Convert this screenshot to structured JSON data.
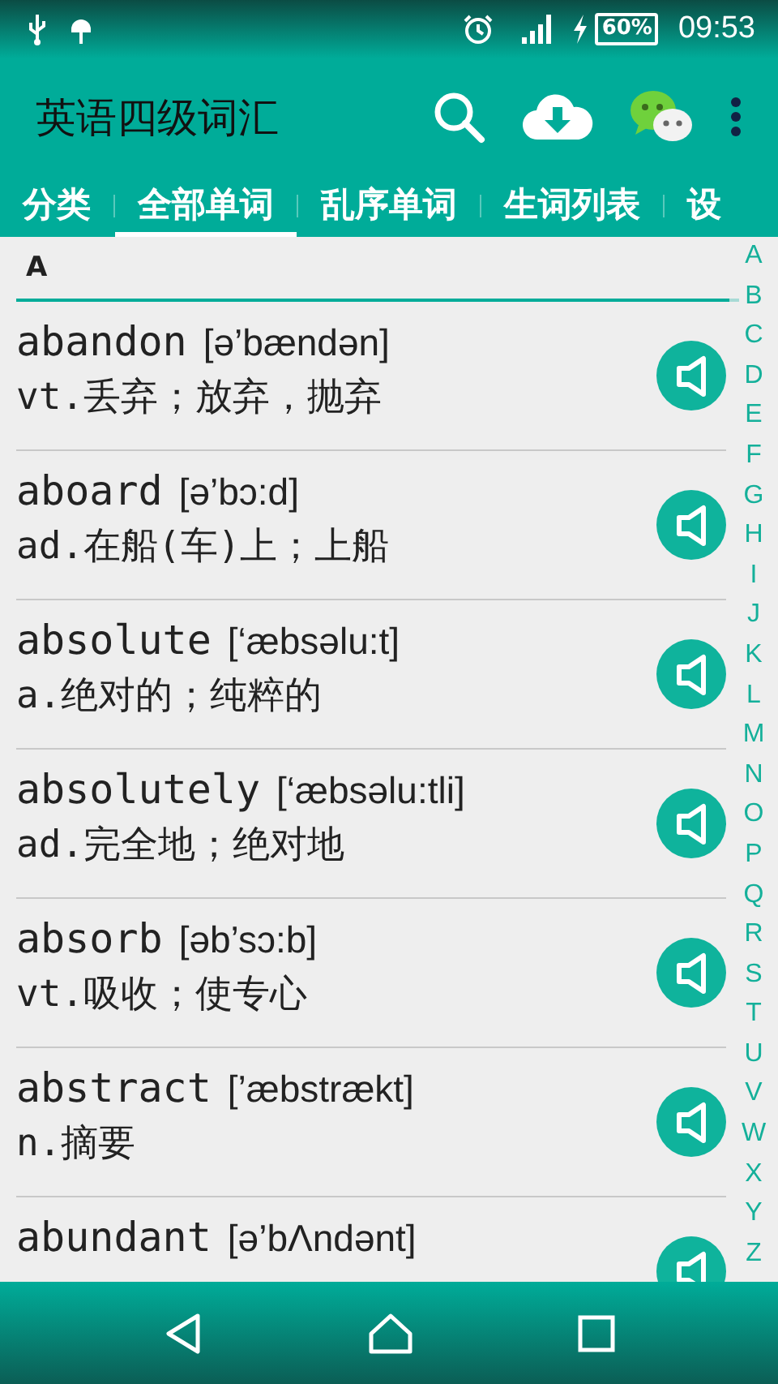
{
  "status_bar": {
    "battery": "60%",
    "time": "09:53"
  },
  "toolbar": {
    "title": "英语四级词汇"
  },
  "tabs": [
    {
      "label": "分类",
      "selected": false
    },
    {
      "label": "全部单词",
      "selected": true
    },
    {
      "label": "乱序单词",
      "selected": false
    },
    {
      "label": "生词列表",
      "selected": false
    },
    {
      "label": "设",
      "selected": false
    }
  ],
  "section_header": "A",
  "words": [
    {
      "word": "abandon",
      "phonetic": "[ə’bændən]",
      "definition": "vt.丢弃；放弃，抛弃"
    },
    {
      "word": "aboard",
      "phonetic": "[ə’bɔ:d]",
      "definition": "ad.在船(车)上；上船"
    },
    {
      "word": "absolute",
      "phonetic": "[‘æbsəlu:t]",
      "definition": "a.绝对的；纯粹的"
    },
    {
      "word": "absolutely",
      "phonetic": "[‘æbsəlu:tli]",
      "definition": "ad.完全地；绝对地"
    },
    {
      "word": "absorb",
      "phonetic": "[əb’sɔ:b]",
      "definition": "vt.吸收；使专心"
    },
    {
      "word": "abstract",
      "phonetic": "[’æbstrækt]",
      "definition": "n.摘要"
    },
    {
      "word": "abundant",
      "phonetic": "[ə’bΛndənt]"
    }
  ],
  "index_letters": [
    "A",
    "B",
    "C",
    "D",
    "E",
    "F",
    "G",
    "H",
    "I",
    "J",
    "K",
    "L",
    "M",
    "N",
    "O",
    "P",
    "Q",
    "R",
    "S",
    "T",
    "U",
    "V",
    "W",
    "X",
    "Y",
    "Z"
  ]
}
